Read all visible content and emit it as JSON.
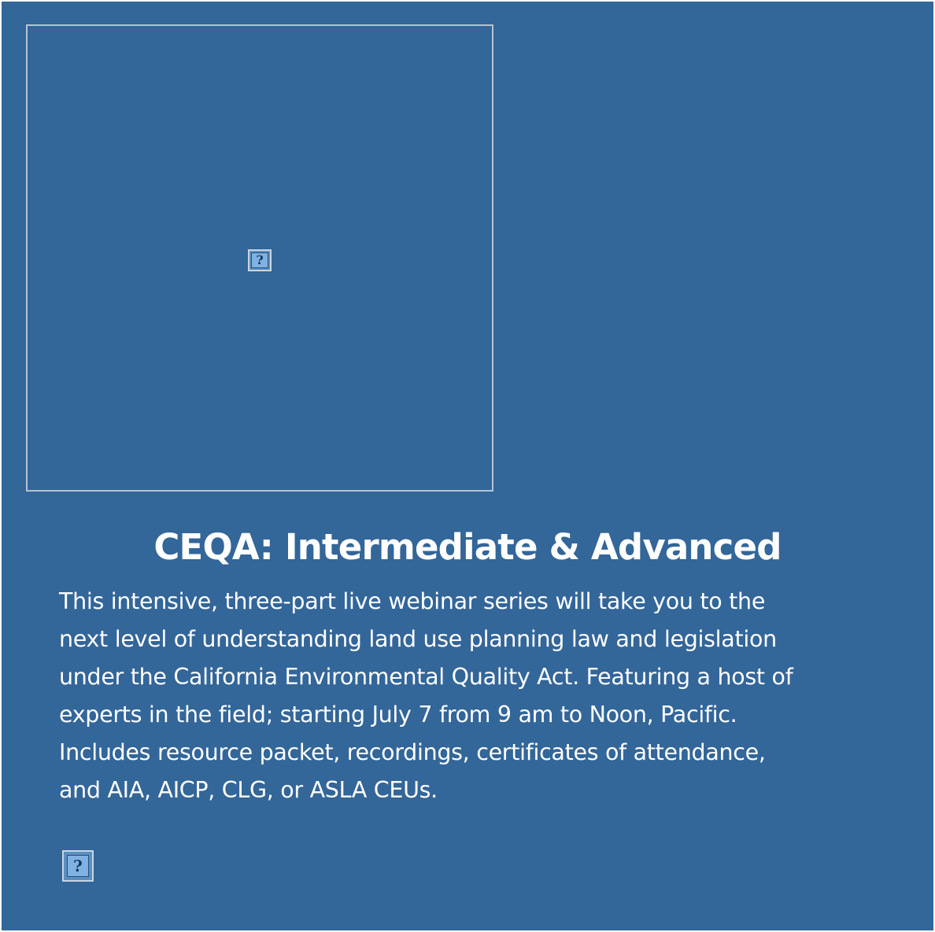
{
  "course": {
    "title": "CEQA: Intermediate & Advanced",
    "description_lines": [
      "This intensive, three-part live webinar series will take you to the",
      "next level of understanding land use planning law and legislation",
      "under the California Environmental Quality Act. Featuring a host of",
      "experts in the field; starting July 7 from 9 am to Noon, Pacific.",
      "Includes resource packet, recordings, certificates of attendance,",
      "and AIA, AICP, CLG, or ASLA CEUs."
    ]
  },
  "images": {
    "main_image_icon": "broken-image-icon",
    "bottom_image_icon": "broken-image-icon",
    "placeholder_glyph": "?"
  },
  "colors": {
    "background": "#336699",
    "text": "#ffffff"
  }
}
